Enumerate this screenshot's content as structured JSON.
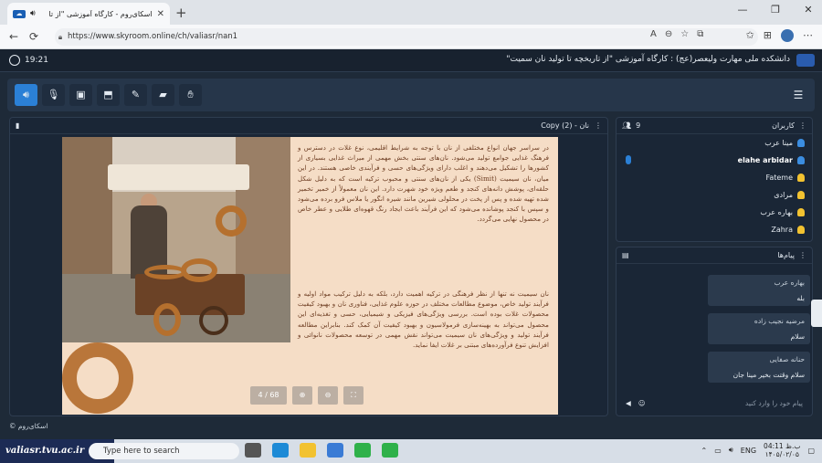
{
  "browser": {
    "tab_title": "اسکای‌روم - کارگاه آموزشی \"از تا",
    "tab_favicon": "skyroom-icon",
    "new_tab": "+",
    "url": "https://www.skyroom.online/ch/valiasr/nan1"
  },
  "header": {
    "time": "19:21",
    "title": "دانشکده ملی مهارت ولیعصر(عج) : کارگاه آموزشی \"از تاریخچه تا تولید نان سمیت\""
  },
  "toolbar": {
    "buttons": [
      "speaker-icon",
      "mic-icon",
      "camera-off-icon",
      "screen-share-icon",
      "brush-icon",
      "folder-icon",
      "raise-hand-icon"
    ],
    "active": "speaker-icon"
  },
  "presentation": {
    "file_name": "نان - (2) Copy",
    "paragraph1": "در سراسر جهان انواع مختلفی از نان با توجه به شرایط اقلیمی، نوع غلات در دسترس و فرهنگ غذایی جوامع تولید می‌شود. نان‌های سنتی بخش مهمی از میراث غذایی بسیاری از کشورها را تشکیل می‌دهند و اغلب دارای ویژگی‌های حسی و فرآیندی خاصی هستند. در این میان، نان سیمیت (Simit) یکی از نان‌های سنتی و محبوب ترکیه است که به دلیل شکل حلقه‌ای، پوشش دانه‌های کنجد و طعم ویژه خود شهرت دارد. این نان معمولاً از خمیر تخمیر شده تهیه شده و پس از پخت در محلولی شیرین مانند شیره انگور یا ملاس فرو برده می‌شود و سپس با کنجد پوشانده می‌شود که این فرآیند باعث ایجاد رنگ قهوه‌ای طلایی و عطر خاص در محصول نهایی می‌گردد.",
    "paragraph2": "نان سیمیت نه تنها از نظر فرهنگی در ترکیه اهمیت دارد، بلکه به دلیل ترکیب مواد اولیه و فرآیند تولید خاص، موضوع مطالعات مختلف در حوزه علوم غذایی، فناوری نان و بهبود کیفیت محصولات غلات بوده است. بررسی ویژگی‌های فیزیکی و شیمیایی، حسی و تغذیه‌ای این محصول می‌تواند به بهینه‌سازی فرمولاسیون و بهبود کیفیت آن کمک کند. بنابراین مطالعه فرآیند تولید و ویژگی‌های نان سیمیت می‌تواند نقش مهمی در توسعه محصولات نانوائی و افزایش تنوع فرآورده‌های مبتنی بر غلات ایفا نماید.",
    "page": "4 / 68"
  },
  "users": {
    "title": "کاربران",
    "count": "9",
    "list": [
      {
        "name": "مینا عرب",
        "color": "#3b8de0"
      },
      {
        "name": "elahe arbidar",
        "color": "#3b8de0"
      },
      {
        "name": "Fateme",
        "color": "#f2c230"
      },
      {
        "name": "مرادی",
        "color": "#f2c230"
      },
      {
        "name": "بهاره عرب",
        "color": "#f2c230"
      },
      {
        "name": "Zahra",
        "color": "#f2c230"
      }
    ]
  },
  "messages": {
    "title": "پیام‌ها",
    "items": [
      {
        "sender": "بهاره عرب",
        "text": "بله"
      },
      {
        "sender": "مرضیه نجیب زاده",
        "text": "سلام"
      },
      {
        "sender": "حنانه صفایی",
        "text": "سلام وقتت بخیر مینا جان"
      }
    ],
    "input_placeholder": "پیام خود را وارد کنید"
  },
  "footer": {
    "brand": "اسکای‌روم"
  },
  "taskbar": {
    "brand_text": "valiasr.tvu.ac.ir",
    "search_placeholder": "Type here to search",
    "lang": "ENG",
    "time": "04:11 ب.ظ",
    "date": "۱۴۰۵/۰۲/۰۵"
  }
}
